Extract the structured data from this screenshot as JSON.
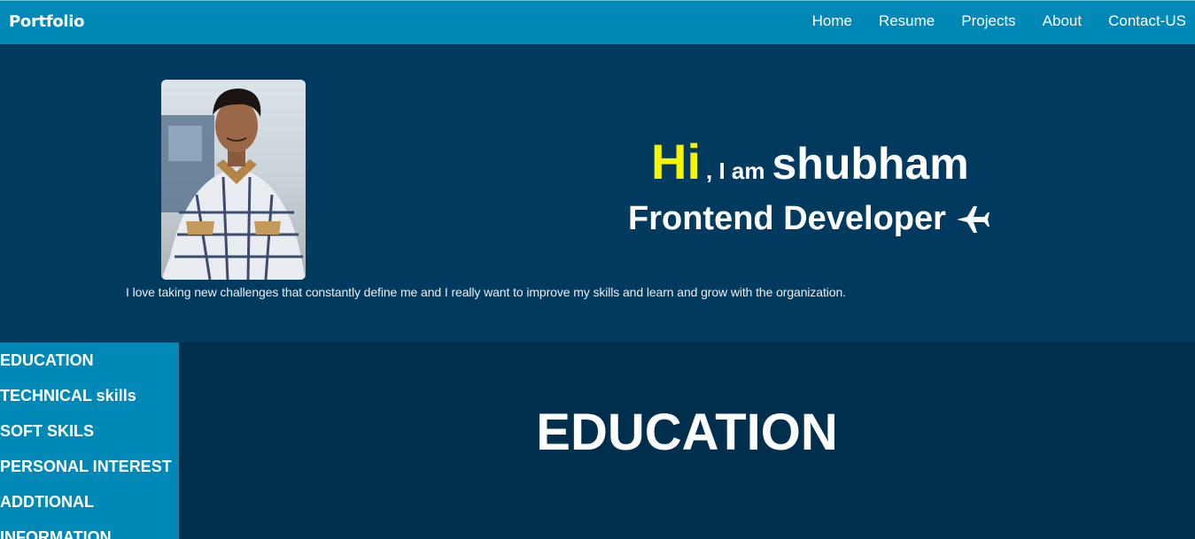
{
  "navbar": {
    "brand": "Portfolio",
    "links": [
      "Home",
      "Resume",
      "Projects",
      "About",
      "Contact-US"
    ]
  },
  "hero": {
    "hi": "Hi",
    "iam": ", I am",
    "name": "shubham",
    "role": "Frontend Developer",
    "role_icon": "airplane-icon",
    "tagline": "I love taking new challenges that constantly define me and I really want to improve my skills and learn and grow with the organization."
  },
  "sidebar": {
    "items": [
      "EDUCATION",
      "TECHNICAL skills",
      "SOFT SKILS",
      "PERSONAL INTEREST",
      "ADDTIONAL",
      "INFORMATION"
    ]
  },
  "content": {
    "title": "EDUCATION"
  },
  "colors": {
    "navbar": "#0089b6",
    "hero_bg": "#003a5e",
    "content_bg": "#002f4e",
    "accent_yellow": "#f5f500"
  }
}
